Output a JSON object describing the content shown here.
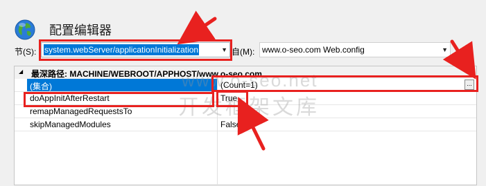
{
  "header": {
    "title": "配置编辑器"
  },
  "toolbar": {
    "section_label": "节(S):",
    "section_value": "system.webServer/applicationInitialization",
    "from_label": "自(M):",
    "from_value": "www.o-seo.com Web.config"
  },
  "grid": {
    "path_label": "最深路径: MACHINE/WEBROOT/APPHOST/www.o-seo.com",
    "rows": [
      {
        "name": "(集合)",
        "value": "(Count=1)"
      },
      {
        "name": "doAppInitAfterRestart",
        "value": "True"
      },
      {
        "name": "remapManagedRequestsTo",
        "value": ""
      },
      {
        "name": "skipManagedModules",
        "value": "False"
      }
    ],
    "ellipsis_label": "..."
  },
  "watermark": {
    "line1": "www.o-seo.net",
    "line2": "开发框架文库"
  },
  "colors": {
    "accent": "#e8211f",
    "selection": "#0078d7"
  }
}
